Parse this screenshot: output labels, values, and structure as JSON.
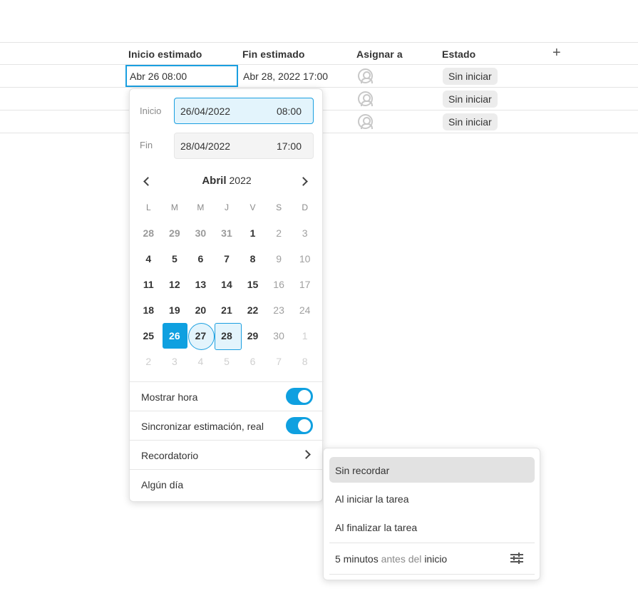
{
  "table": {
    "headers": {
      "start": "Inicio estimado",
      "end": "Fin estimado",
      "assign": "Asignar a",
      "status": "Estado",
      "add": "+"
    },
    "rows": [
      {
        "start": "Abr 26 08:00",
        "end": "Abr 28, 2022 17:00",
        "status": "Sin iniciar"
      },
      {
        "status": "Sin iniciar"
      },
      {
        "status": "Sin iniciar"
      }
    ]
  },
  "datepicker": {
    "start_label": "Inicio",
    "start_date": "26/04/2022",
    "start_time": "08:00",
    "end_label": "Fin",
    "end_date": "28/04/2022",
    "end_time": "17:00",
    "month": "Abril",
    "year": "2022",
    "weekdays": [
      "L",
      "M",
      "M",
      "J",
      "V",
      "S",
      "D"
    ],
    "days": [
      "28",
      "29",
      "30",
      "31",
      "1",
      "2",
      "3",
      "4",
      "5",
      "6",
      "7",
      "8",
      "9",
      "10",
      "11",
      "12",
      "13",
      "14",
      "15",
      "16",
      "17",
      "18",
      "19",
      "20",
      "21",
      "22",
      "23",
      "24",
      "25",
      "26",
      "27",
      "28",
      "29",
      "30",
      "1",
      "2",
      "3",
      "4",
      "5",
      "6",
      "7",
      "8"
    ],
    "selected_start": "26",
    "selected_end": "28",
    "options": {
      "show_time": "Mostrar hora",
      "sync": "Sincronizar estimación, real",
      "reminder": "Recordatorio",
      "someday": "Algún día"
    },
    "show_time_on": true,
    "sync_on": true
  },
  "reminder_menu": {
    "items": [
      "Sin recordar",
      "Al iniciar la tarea",
      "Al finalizar la tarea"
    ],
    "custom_a": "5 minutos",
    "custom_b": "antes del",
    "custom_c": "inicio"
  },
  "colors": {
    "accent": "#0fa0e0",
    "accent_light": "#e3f4fc",
    "badge_bg": "#ececec"
  }
}
